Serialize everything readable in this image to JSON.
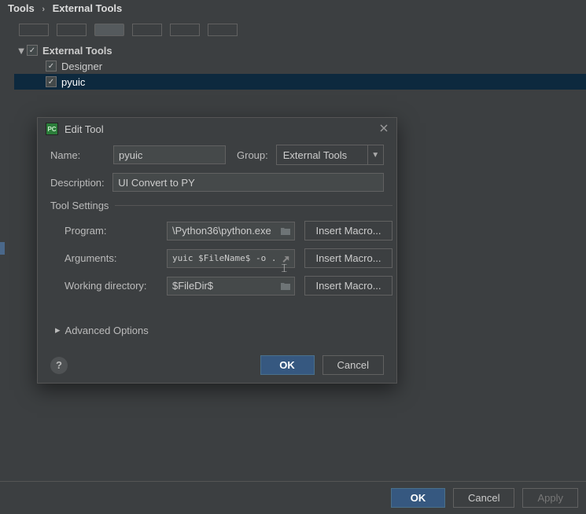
{
  "breadcrumb": {
    "root": "Tools",
    "child": "External Tools"
  },
  "tree": {
    "root_label": "External Tools",
    "items": [
      "Designer",
      "pyuic"
    ]
  },
  "dialog": {
    "title": "Edit Tool",
    "name_label": "Name:",
    "name_value": "pyuic",
    "group_label": "Group:",
    "group_value": "External Tools",
    "description_label": "Description:",
    "description_value": "UI Convert to PY",
    "tool_settings_legend": "Tool Settings",
    "program_label": "Program:",
    "program_value": "\\Python36\\python.exe",
    "arguments_label": "Arguments:",
    "arguments_value": "yuic $FileName$ -o .py",
    "workdir_label": "Working directory:",
    "workdir_value": "$FileDir$",
    "insert_macro_label": "Insert Macro...",
    "advanced_label": "Advanced Options",
    "ok_label": "OK",
    "cancel_label": "Cancel"
  },
  "bottom": {
    "ok_label": "OK",
    "cancel_label": "Cancel",
    "apply_label": "Apply"
  }
}
